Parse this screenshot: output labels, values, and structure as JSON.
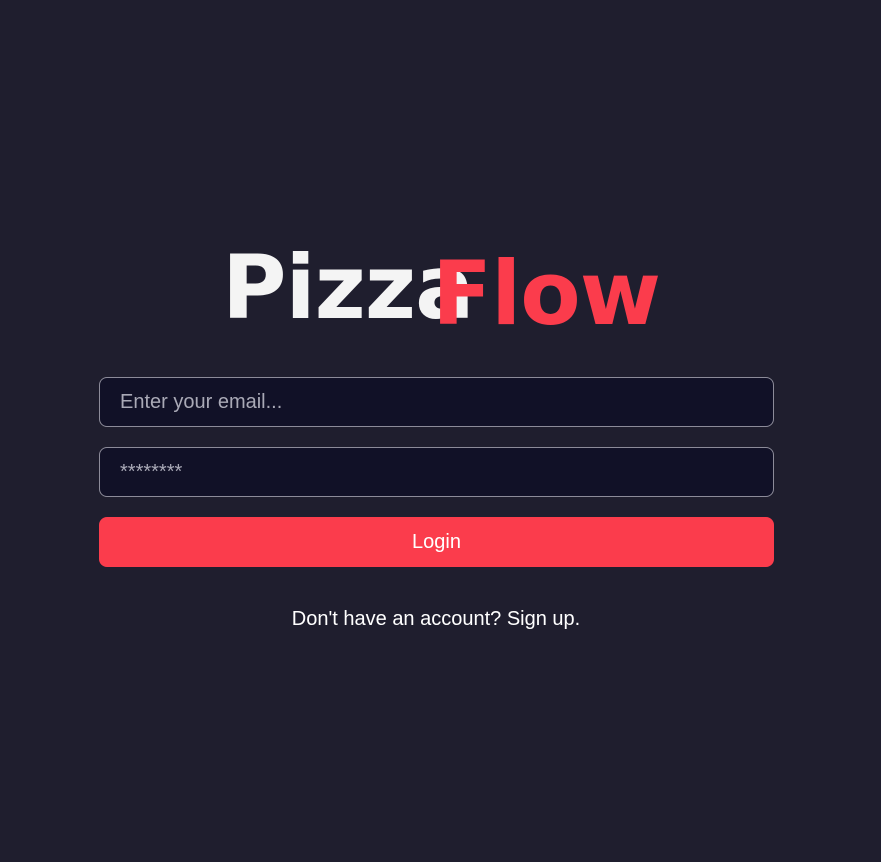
{
  "brand": {
    "part_a": "Pizza",
    "part_b": "Flow",
    "color_a": "#f4f4f4",
    "color_b": "#fb3c4c"
  },
  "form": {
    "email_placeholder": "Enter your email...",
    "email_value": "",
    "password_placeholder": "********",
    "password_value": "",
    "login_label": "Login"
  },
  "footer": {
    "signup_text": "Don't have an account? Sign up."
  },
  "colors": {
    "background": "#1f1e2e",
    "input_background": "#111127",
    "input_border": "#8c8b99",
    "accent": "#fb3c4c"
  }
}
